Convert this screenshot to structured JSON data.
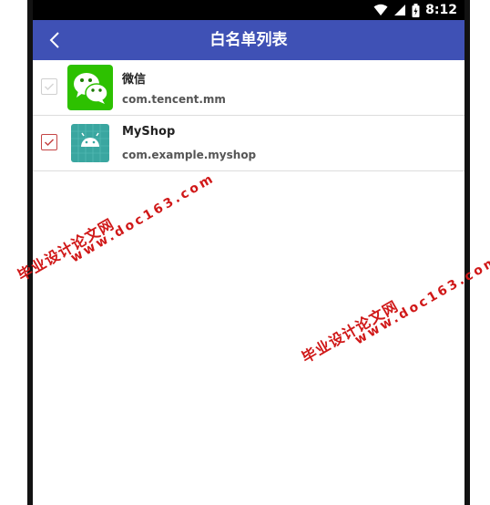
{
  "status_bar": {
    "time": "8:12"
  },
  "app_bar": {
    "title": "白名单列表",
    "back_icon": "chevron-left-icon"
  },
  "apps": [
    {
      "name": "微信",
      "package": "com.tencent.mm",
      "checked": false,
      "icon": "wechat-icon"
    },
    {
      "name": "MyShop",
      "package": "com.example.myshop",
      "checked": true,
      "icon": "android-icon"
    }
  ],
  "watermark": {
    "site": "毕业设计论文网",
    "url": "www.doc163.com"
  },
  "colors": {
    "appbar": "#3f51b5",
    "checked": "#c54545",
    "wechat": "#2dc100",
    "android_tile": "#3aa6a0"
  }
}
